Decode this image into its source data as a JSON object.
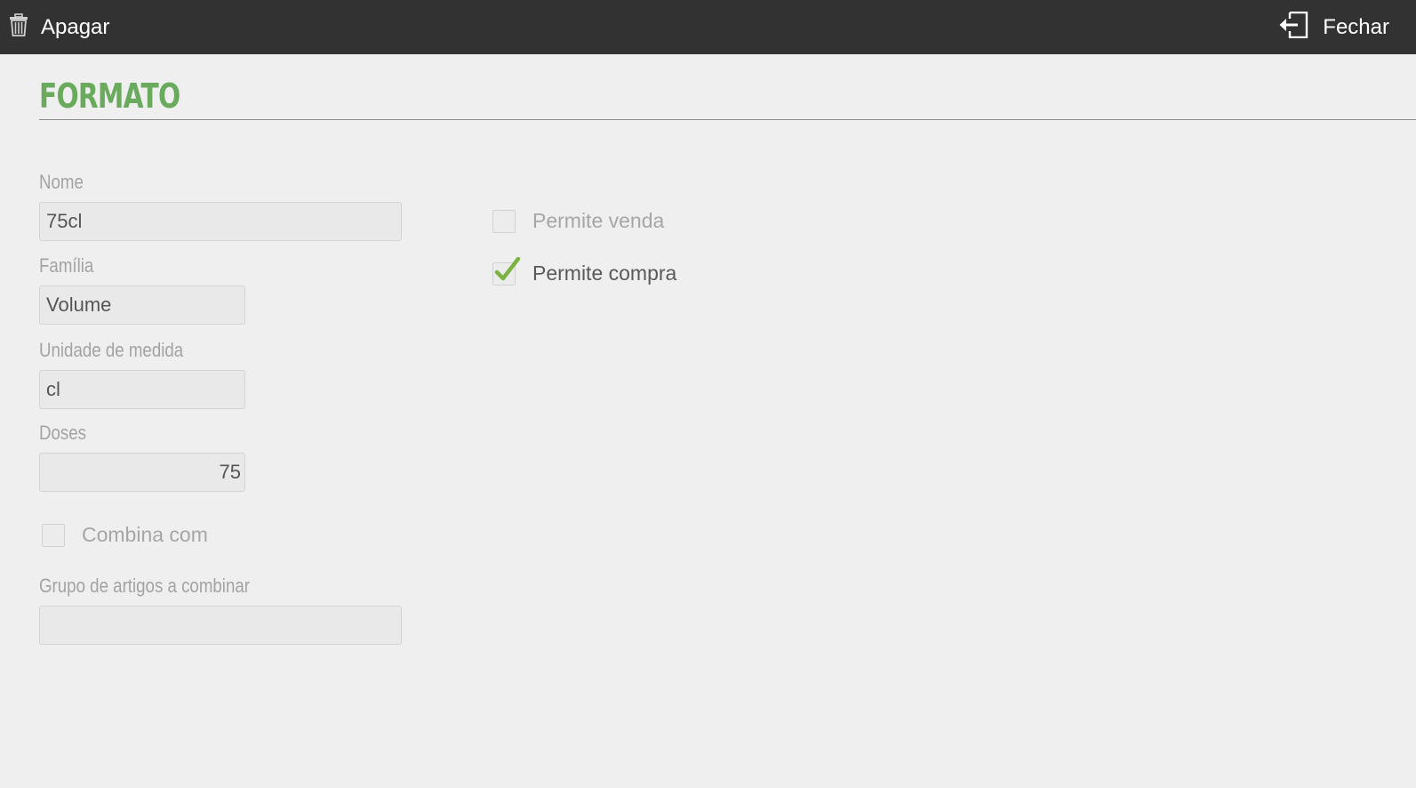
{
  "toolbar": {
    "delete_label": "Apagar",
    "close_label": "Fechar",
    "delete_icon": "trash-icon",
    "close_icon": "exit-door-icon",
    "background_color": "#323232"
  },
  "page": {
    "title": "FORMATO",
    "title_color": "#6aaa5c"
  },
  "form": {
    "nome": {
      "label": "Nome",
      "value": "75cl"
    },
    "familia": {
      "label": "Família",
      "value": "Volume"
    },
    "unidade": {
      "label": "Unidade de medida",
      "value": "cl"
    },
    "doses": {
      "label": "Doses",
      "value": "75"
    },
    "combina": {
      "label": "Combina com",
      "checked": false
    },
    "grupo": {
      "label": "Grupo de artigos a combinar",
      "value": ""
    },
    "permite_venda": {
      "label": "Permite venda",
      "checked": false
    },
    "permite_compra": {
      "label": "Permite compra",
      "checked": true
    }
  },
  "colors": {
    "check_green": "#7cb342",
    "label_gray": "#a3a3a3"
  }
}
